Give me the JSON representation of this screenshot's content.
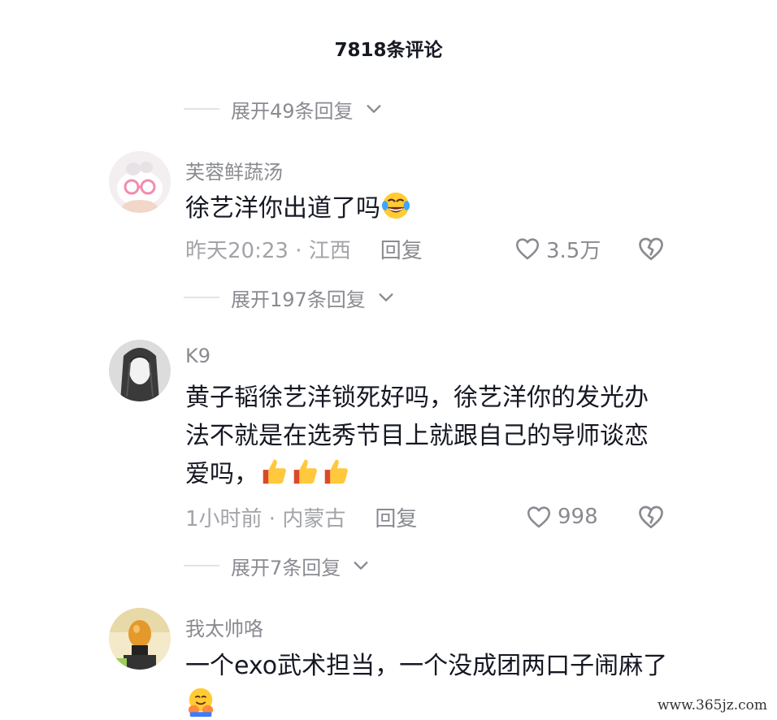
{
  "header": {
    "title": "7818条评论"
  },
  "expand_top": {
    "label": "展开49条回复"
  },
  "comments": [
    {
      "username": "芙蓉鲜蔬汤",
      "text": "徐艺洋你出道了吗",
      "emoji": "rofl-emoji",
      "time_location": "昨天20:23 · 江西",
      "reply_label": "回复",
      "likes": "3.5万",
      "expand_label": "展开197条回复"
    },
    {
      "username": "K9",
      "text": "黄子韬徐艺洋锁死好吗，徐艺洋你的发光办法不就是在选秀节目上就跟自己的导师谈恋爱吗，",
      "emoji": "thumbs-up-emoji",
      "time_location": "1小时前 · 内蒙古",
      "reply_label": "回复",
      "likes": "998",
      "expand_label": "展开7条回复"
    },
    {
      "username": "我太帅咯",
      "text": "一个exo武术担当，一个没成团两口子闹麻了",
      "emoji": "hug-emoji"
    }
  ],
  "watermark": "www.365jz.com",
  "colors": {
    "primary_text": "#161823",
    "secondary_text": "#8a8b91",
    "meta_text": "#a3a4a8"
  }
}
